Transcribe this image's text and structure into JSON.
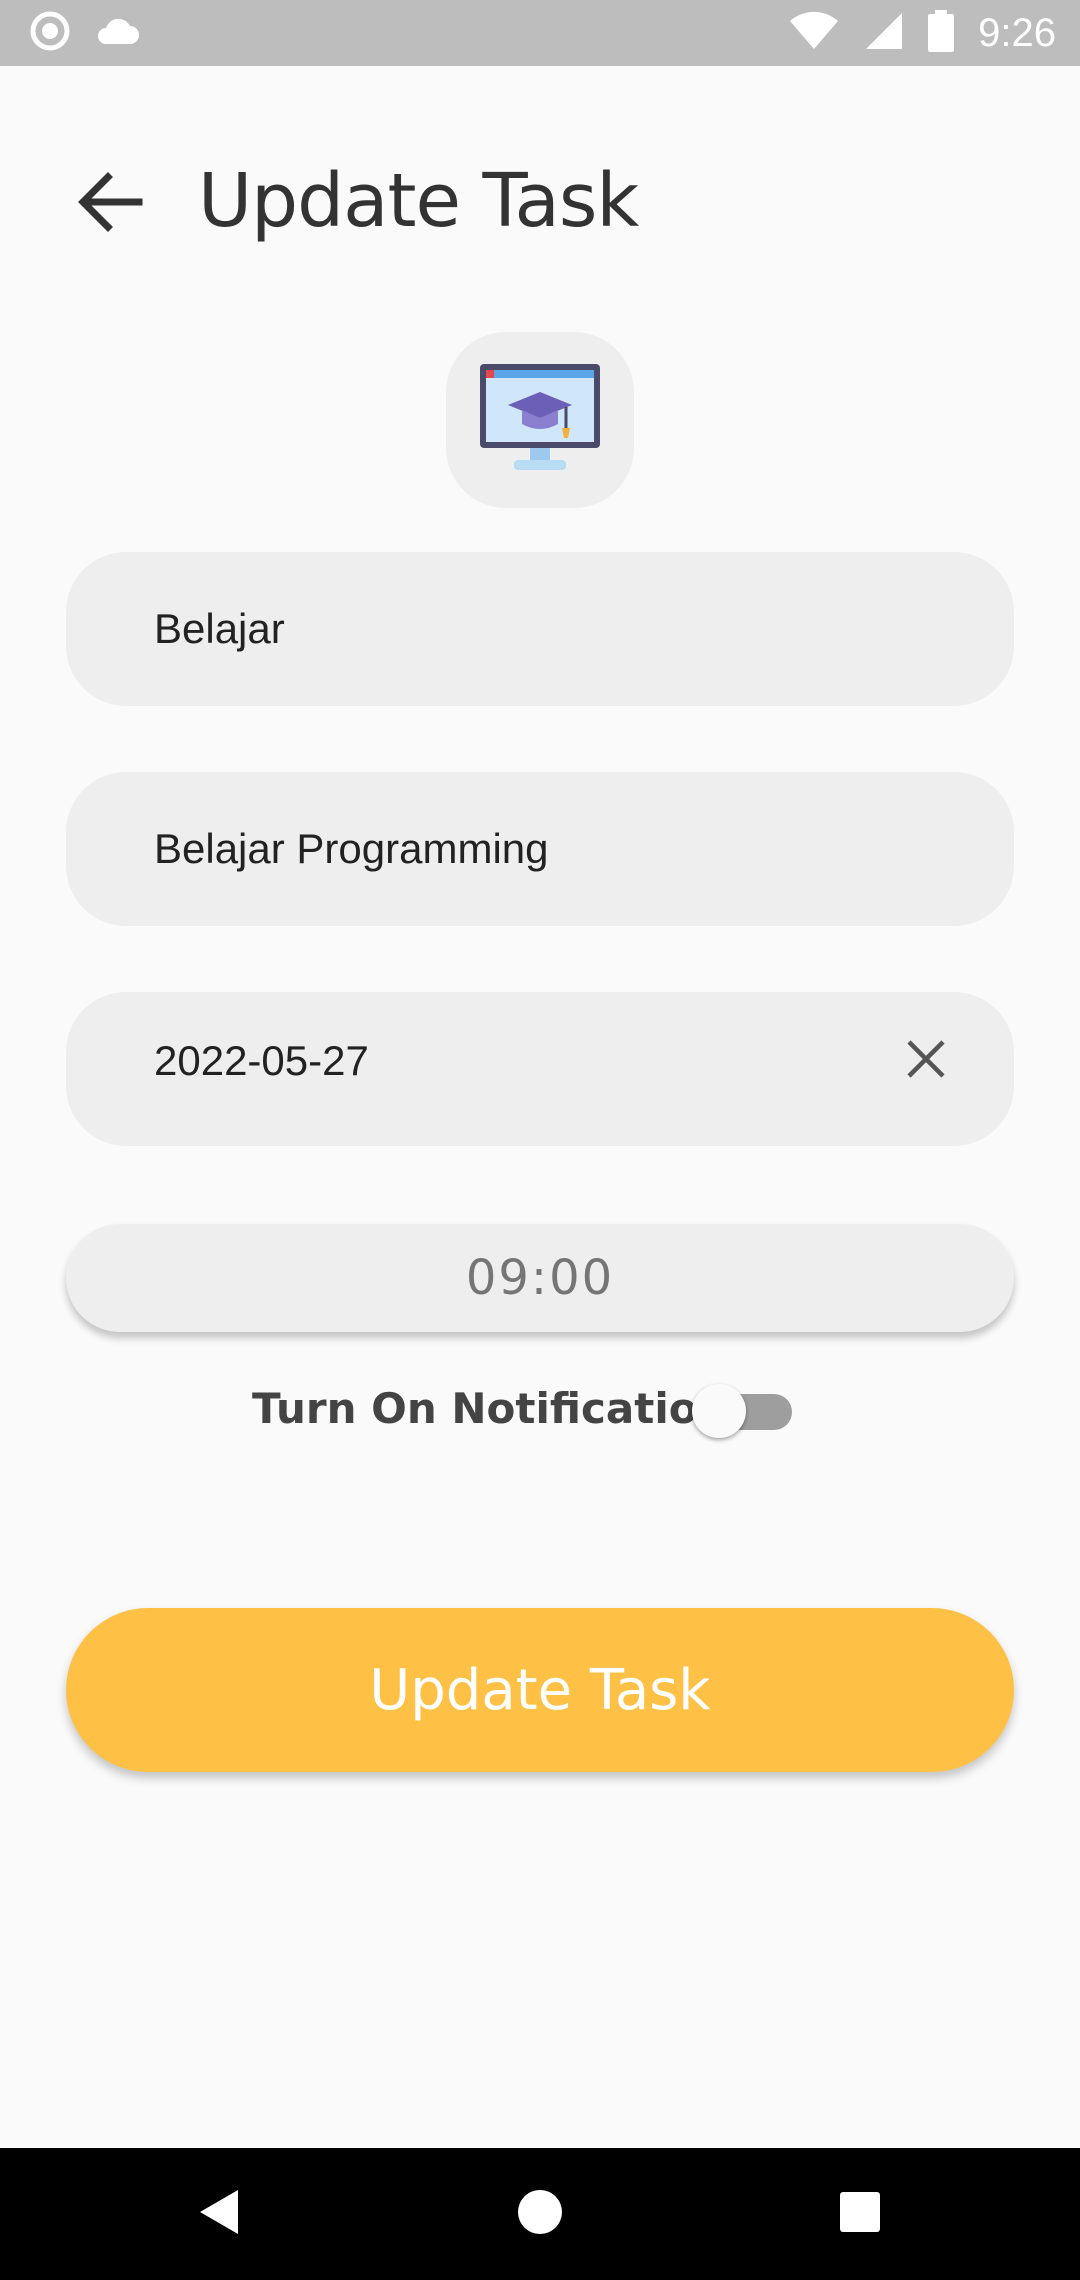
{
  "status_bar": {
    "time": "9:26",
    "icons": [
      "record-icon",
      "cloud-icon",
      "wifi-icon",
      "signal-icon",
      "battery-icon"
    ]
  },
  "app_bar": {
    "title": "Update Task",
    "back_icon": "arrow-back-icon"
  },
  "category": {
    "icon": "graduation-monitor-icon"
  },
  "form": {
    "title_value": "Belajar",
    "description_value": "Belajar Programming",
    "date_value": "2022-05-27",
    "clear_icon": "close-icon",
    "time_value": "09:00"
  },
  "notification": {
    "label": "Turn On Notification",
    "enabled": false
  },
  "submit": {
    "label": "Update Task"
  },
  "colors": {
    "accent": "#ffc145",
    "field_bg": "#eeeeee",
    "background": "#fafafa",
    "status_bar": "#bdbdbd"
  },
  "nav_bar": {
    "icons": [
      "back-triangle-icon",
      "home-circle-icon",
      "recents-square-icon"
    ]
  }
}
